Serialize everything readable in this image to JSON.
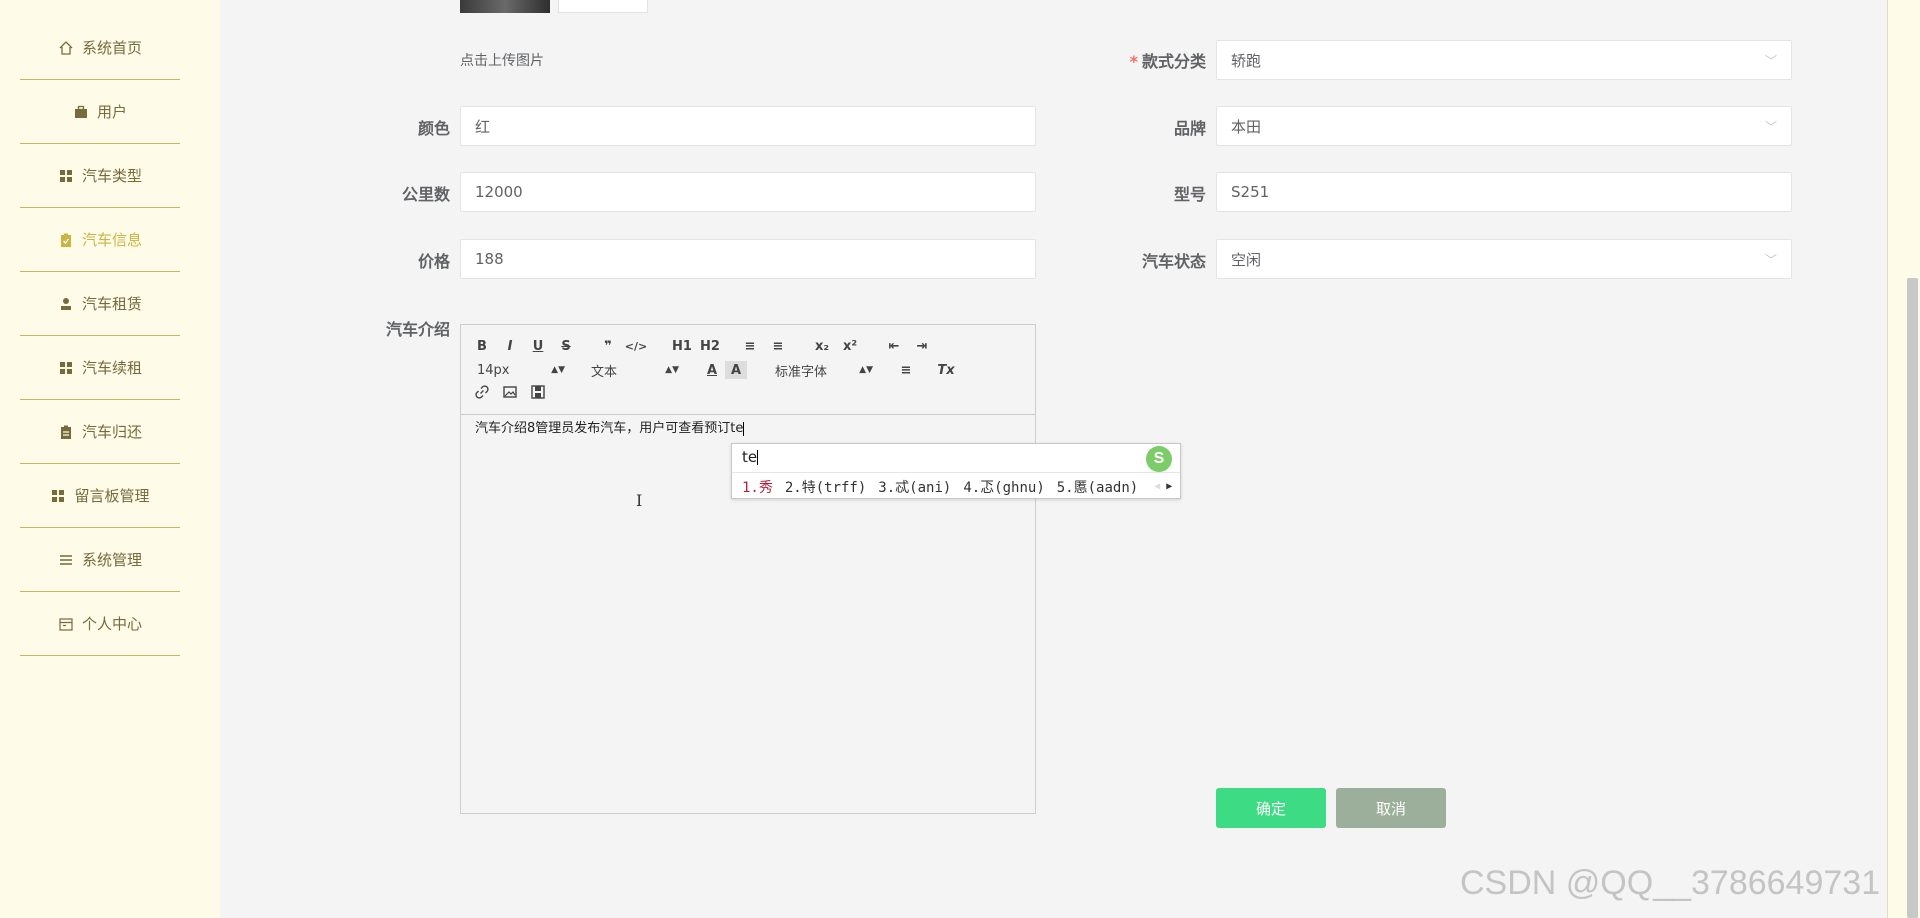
{
  "sidebar": {
    "items": [
      {
        "label": "系统首页",
        "icon": "home-icon",
        "active": false
      },
      {
        "label": "用户",
        "icon": "briefcase-icon",
        "active": false
      },
      {
        "label": "汽车类型",
        "icon": "grid-icon",
        "active": false
      },
      {
        "label": "汽车信息",
        "icon": "clipboard-icon",
        "active": true
      },
      {
        "label": "汽车租赁",
        "icon": "user-icon",
        "active": false
      },
      {
        "label": "汽车续租",
        "icon": "grid-icon",
        "active": false
      },
      {
        "label": "汽车归还",
        "icon": "clipboard-icon",
        "active": false
      },
      {
        "label": "留言板管理",
        "icon": "grid-icon",
        "active": false
      },
      {
        "label": "系统管理",
        "icon": "list-icon",
        "active": false
      },
      {
        "label": "个人中心",
        "icon": "calendar-icon",
        "active": false
      }
    ]
  },
  "form": {
    "upload_hint": "点击上传图片",
    "style_category": {
      "label": "款式分类",
      "required": true,
      "value": "轿跑"
    },
    "color": {
      "label": "颜色",
      "value": "红"
    },
    "brand": {
      "label": "品牌",
      "value": "本田"
    },
    "mileage": {
      "label": "公里数",
      "value": "12000"
    },
    "model": {
      "label": "型号",
      "value": "S251"
    },
    "price": {
      "label": "价格",
      "value": "188"
    },
    "status": {
      "label": "汽车状态",
      "value": "空闲"
    },
    "intro": {
      "label": "汽车介绍"
    }
  },
  "editor": {
    "toolbar": {
      "bold": "B",
      "italic": "I",
      "underline": "U",
      "strike": "S",
      "quote": "❞",
      "code": "</>",
      "h1": "H1",
      "h2": "H2",
      "ordered_list": "≡",
      "bullet_list": "≡",
      "subscript": "x₂",
      "superscript": "x²",
      "outdent": "⇤",
      "indent": "⇥",
      "size": "14px",
      "block": "文本",
      "font": "标准字体",
      "align": "≡",
      "clear": "Tx"
    },
    "content": "汽车介绍8管理员发布汽车，用户可查看预订te"
  },
  "ime": {
    "input": "te",
    "candidates": [
      "1.秀",
      "2.特(trff)",
      "3.忒(ani)",
      "4.忑(ghnu)",
      "5.慝(aadn)"
    ]
  },
  "buttons": {
    "confirm": "确定",
    "cancel": "取消"
  },
  "watermark": "CSDN @QQ__3786649731",
  "colors": {
    "accent_gold": "#c9b444",
    "confirm_green": "#3ddc84",
    "cancel_gray": "#9caf9a"
  }
}
